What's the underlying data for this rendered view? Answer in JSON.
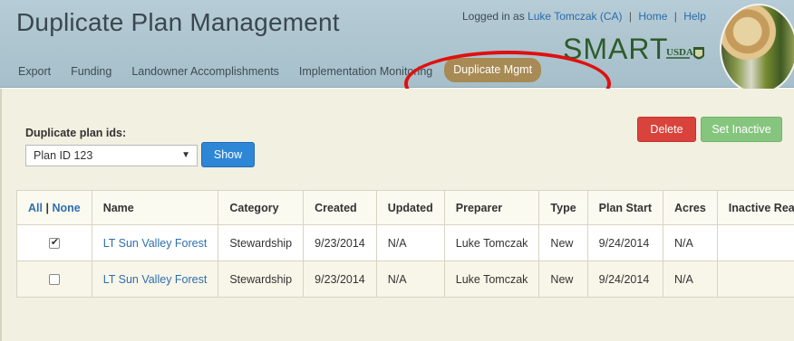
{
  "header": {
    "title": "Duplicate Plan Management",
    "logged_in_prefix": "Logged in as ",
    "user": "Luke Tomczak (CA)",
    "home_link": "Home",
    "help_link": "Help",
    "separator": "|",
    "brand": "SMART",
    "usda_label": "USDA"
  },
  "nav": {
    "items": [
      {
        "label": "Export"
      },
      {
        "label": "Funding"
      },
      {
        "label": "Landowner Accomplishments"
      },
      {
        "label": "Implementation Monitoring"
      },
      {
        "label": "Duplicate Mgmt"
      }
    ],
    "active_index": 4
  },
  "annotation": {
    "color": "#e01010"
  },
  "form": {
    "label": "Duplicate plan ids:",
    "selected_plan": "Plan ID 123",
    "show_button": "Show",
    "delete_button": "Delete",
    "set_inactive_button": "Set Inactive"
  },
  "table": {
    "select_all": "All",
    "select_none": "None",
    "columns": [
      "Name",
      "Category",
      "Created",
      "Updated",
      "Preparer",
      "Type",
      "Plan Start",
      "Acres",
      "Inactive Reason"
    ],
    "rows": [
      {
        "checked": true,
        "name": "LT Sun Valley Forest",
        "category": "Stewardship",
        "created": "9/23/2014",
        "updated": "N/A",
        "preparer": "Luke Tomczak",
        "type": "New",
        "plan_start": "9/24/2014",
        "acres": "N/A",
        "inactive_reason": ""
      },
      {
        "checked": false,
        "name": "LT Sun Valley Forest",
        "category": "Stewardship",
        "created": "9/23/2014",
        "updated": "N/A",
        "preparer": "Luke Tomczak",
        "type": "New",
        "plan_start": "9/24/2014",
        "acres": "N/A",
        "inactive_reason": ""
      }
    ]
  },
  "colors": {
    "header_bg": "#b6ccd6",
    "active_tab": "#a88a55",
    "show_button": "#2e86d6",
    "delete_button": "#d9433b",
    "set_inactive_button": "#86c57e",
    "link": "#2e6fae"
  }
}
